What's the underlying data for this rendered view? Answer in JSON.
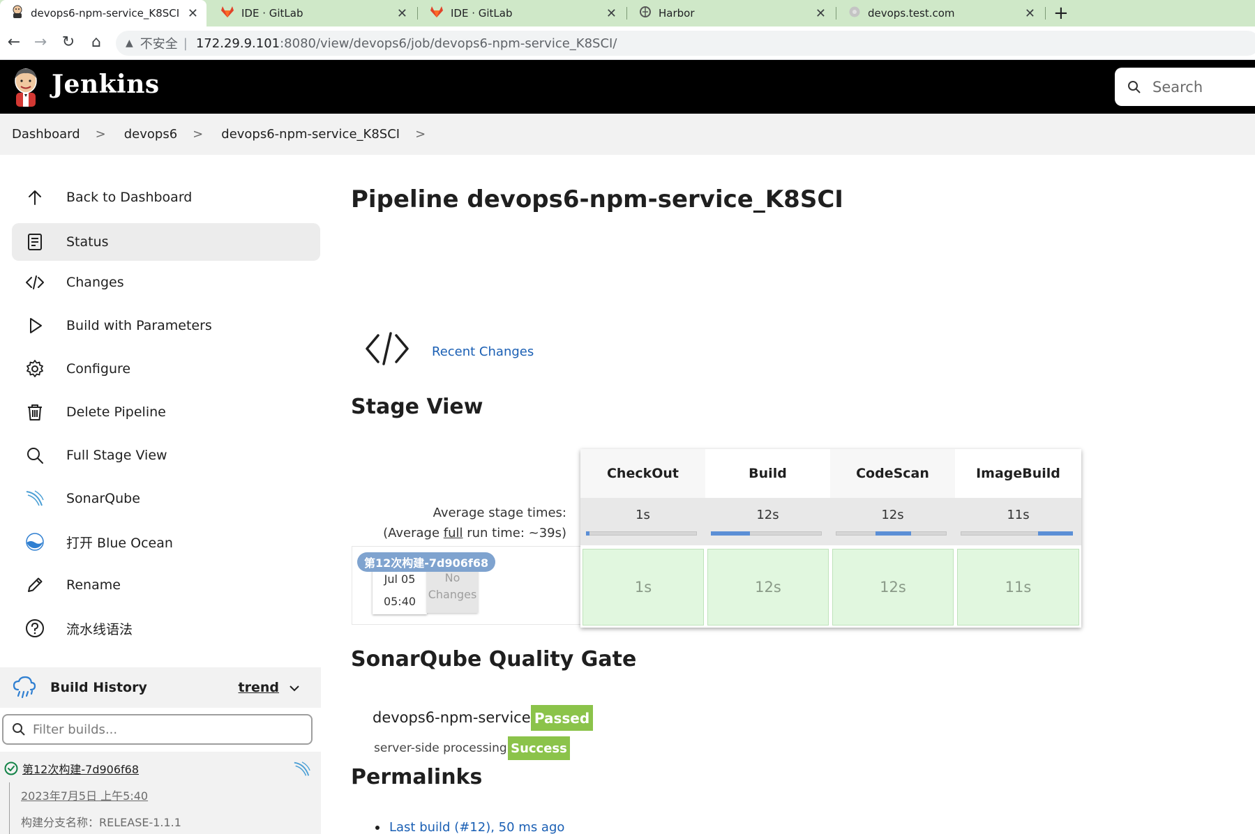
{
  "browser": {
    "tabs": [
      {
        "title": "devops6-npm-service_K8SCI [Jenkins]",
        "active": true
      },
      {
        "title": "IDE · GitLab",
        "active": false
      },
      {
        "title": "IDE · GitLab",
        "active": false
      },
      {
        "title": "Harbor",
        "active": false
      },
      {
        "title": "devops.test.com",
        "active": false
      }
    ],
    "new_tab": "+",
    "address": {
      "insecure": "不安全",
      "host": "172.29.9.101",
      "path": ":8080/view/devops6/job/devops6-npm-service_K8SCI/"
    }
  },
  "header": {
    "brand": "Jenkins",
    "search_placeholder": "Search"
  },
  "breadcrumbs": [
    "Dashboard",
    "devops6",
    "devops6-npm-service_K8SCI"
  ],
  "sidebar": {
    "items": [
      {
        "label": "Back to Dashboard",
        "icon": "arrow-up-icon"
      },
      {
        "label": "Status",
        "icon": "document-icon",
        "active": true
      },
      {
        "label": "Changes",
        "icon": "code-icon"
      },
      {
        "label": "Build with Parameters",
        "icon": "play-icon"
      },
      {
        "label": "Configure",
        "icon": "gear-icon"
      },
      {
        "label": "Delete Pipeline",
        "icon": "trash-icon"
      },
      {
        "label": "Full Stage View",
        "icon": "search-icon"
      },
      {
        "label": "SonarQube",
        "icon": "sonarqube-icon"
      },
      {
        "label": "打开 Blue Ocean",
        "icon": "blue-ocean-icon"
      },
      {
        "label": "Rename",
        "icon": "pencil-icon"
      },
      {
        "label": "流水线语法",
        "icon": "help-icon"
      }
    ]
  },
  "build_history": {
    "title": "Build History",
    "trend": "trend",
    "filter_placeholder": "Filter builds...",
    "entries": [
      {
        "name": "第12次构建-7d906f68",
        "date": "2023年7月5日 上午5:40",
        "description": "构建分支名称：RELEASE-1.1.1",
        "status": "success"
      }
    ]
  },
  "main": {
    "title": "Pipeline devops6-npm-service_K8SCI",
    "recent_changes": "Recent Changes",
    "stage_view_title": "Stage View",
    "avg_stage_times": "Average stage times:",
    "avg_full_run": {
      "prefix": "(Average ",
      "link": "full",
      "suffix": " run time: ~39s)"
    },
    "stages": [
      {
        "name": "CheckOut",
        "avg": "1s",
        "bar_start": 0.0,
        "bar_end": 0.03,
        "run": "1s"
      },
      {
        "name": "Build",
        "avg": "12s",
        "bar_start": 0.0,
        "bar_end": 0.35,
        "run": "12s"
      },
      {
        "name": "CodeScan",
        "avg": "12s",
        "bar_start": 0.36,
        "bar_end": 0.68,
        "run": "12s"
      },
      {
        "name": "ImageBuild",
        "avg": "11s",
        "bar_start": 0.69,
        "bar_end": 1.0,
        "run": "11s"
      }
    ],
    "run": {
      "badge": "第12次构建-7d906f68",
      "date": "Jul 05",
      "time": "05:40",
      "no_changes_1": "No",
      "no_changes_2": "Changes"
    },
    "sonar_title": "SonarQube Quality Gate",
    "sonar": {
      "project": "devops6-npm-service",
      "gate": "Passed",
      "ssp_label": "server-side processing:",
      "ssp_value": "Success"
    },
    "permalinks_title": "Permalinks",
    "permalinks": [
      "Last build (#12), 50 ms ago"
    ]
  },
  "colors": {
    "success_green": "#8bc34a",
    "stage_cell_bg": "#e1f7df",
    "stage_bar_blue": "#5b8fd6",
    "link_blue": "#1a5fb4"
  }
}
